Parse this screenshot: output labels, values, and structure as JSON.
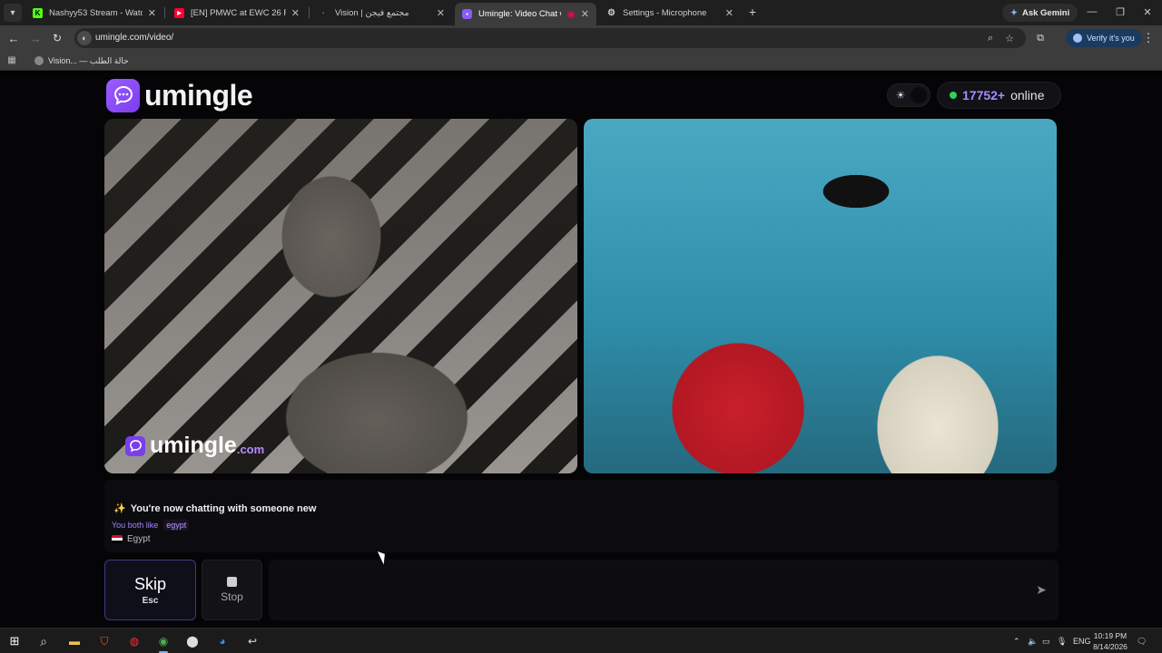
{
  "browser": {
    "tabs": [
      {
        "title": "Nashyy53 Stream - Watch Live",
        "favicon_color": "#53fc18",
        "favicon_glyph": "K",
        "active": false
      },
      {
        "title": "[EN] PMWC at EWC 26 Finals D",
        "favicon_color": "#ff0033",
        "favicon_glyph": "▶",
        "active": false
      },
      {
        "title": "Vision | مجتمع فيجن",
        "favicon_color": "#888888",
        "favicon_glyph": "·",
        "active": false
      },
      {
        "title": "Umingle: Video Chat with S",
        "favicon_color": "#8b5cf6",
        "favicon_glyph": "●",
        "active": true
      },
      {
        "title": "Settings - Microphone",
        "favicon_color": "#bbbbbb",
        "favicon_glyph": "⚙",
        "active": false
      }
    ],
    "ask_gemini": "Ask Gemini",
    "url": "umingle.com/video/",
    "verify_label": "Verify it's you",
    "bookmark_label": "Vision... — حالة الطلب"
  },
  "header": {
    "logo_text": "umingle",
    "online_count": "17752+",
    "online_label": "online"
  },
  "videos": {
    "watermark_text": "umingle",
    "watermark_suffix": ".com"
  },
  "chat": {
    "system_message": "You're now chatting with someone new",
    "likes_label": "You both like",
    "like_tag": "egypt",
    "country": "Egypt"
  },
  "controls": {
    "skip_label": "Skip",
    "skip_key": "Esc",
    "stop_label": "Stop",
    "message_placeholder": ""
  },
  "taskbar": {
    "language": "ENG",
    "time": "10:19 PM",
    "date": "8/14/2026"
  },
  "colors": {
    "accent": "#8b5cf6",
    "online_dot": "#34d058",
    "online_count": "#a98bff"
  }
}
